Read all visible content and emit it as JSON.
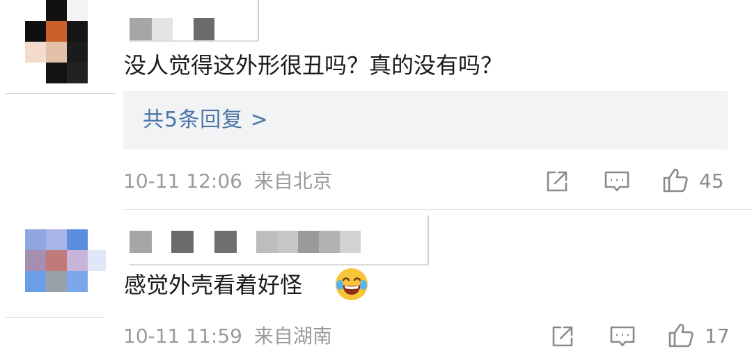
{
  "comments": [
    {
      "text": "没人觉得这外形很丑吗？真的没有吗？",
      "replies_label": "共5条回复 >",
      "time": "10-11 12:06",
      "location": "来自北京",
      "like_count": "45"
    },
    {
      "text": "感觉外壳看着好怪",
      "emoji": "laughing-tears-emoji",
      "time": "10-11 11:59",
      "location": "来自湖南",
      "like_count": "17"
    }
  ],
  "icons": {
    "forward": "forward-icon",
    "reply": "comment-icon",
    "like": "thumbs-up-icon"
  },
  "colors": {
    "link": "#4a74a6",
    "meta": "#9a9a9a",
    "reply_bg": "#f2f3f5"
  }
}
